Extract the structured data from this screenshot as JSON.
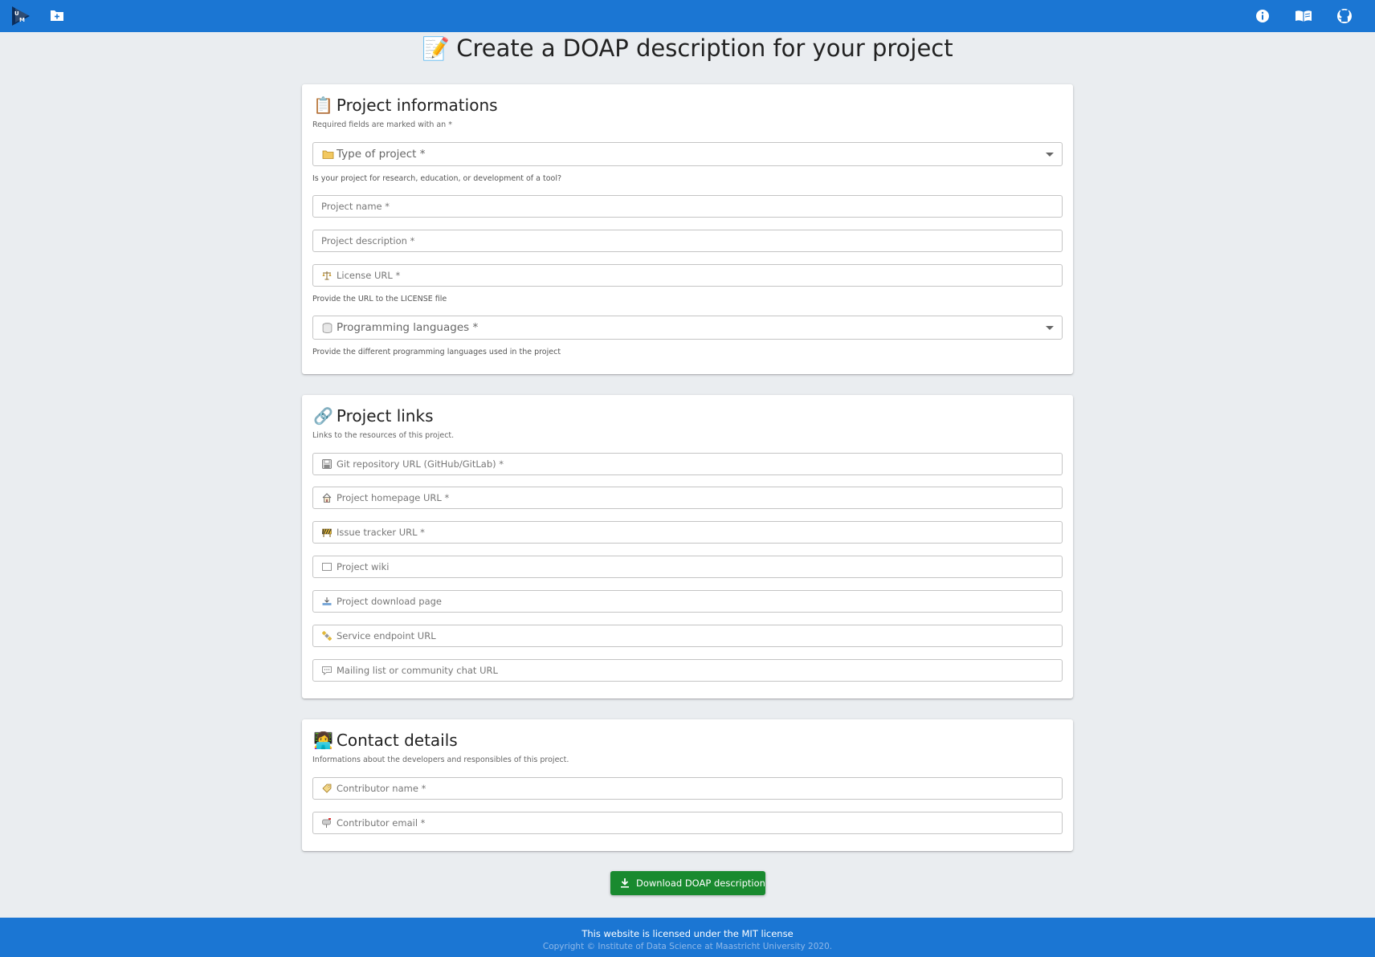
{
  "header": {
    "logo_icon": "maastricht-university-logo",
    "add_project_icon": "folder-plus-icon",
    "right_icons": [
      "info-icon",
      "book-icon",
      "github-icon"
    ],
    "color": "#1b76d3"
  },
  "page": {
    "title_emoji": "📝",
    "title": "Create a DOAP description for your project"
  },
  "project_info": {
    "emoji": "📋",
    "title": "Project informations",
    "subtitle": "Required fields are marked with an *",
    "type_select": {
      "icon": "folder-icon",
      "placeholder": "Type of project *",
      "helper": "Is your project for research, education, or development of a tool?"
    },
    "name_placeholder": "Project name *",
    "description_placeholder": "Project description *",
    "license": {
      "icon": "scales-icon",
      "placeholder": "License URL *",
      "helper": "Provide the URL to the LICENSE file"
    },
    "languages_select": {
      "icon": "database-icon",
      "placeholder": "Programming languages *",
      "helper": "Provide the different programming languages used in the project"
    }
  },
  "project_links": {
    "emoji": "🔗",
    "title": "Project links",
    "subtitle": "Links to the resources of this project.",
    "fields": [
      {
        "icon": "floppy-disk-icon",
        "placeholder": "Git repository URL (GitHub/GitLab) *"
      },
      {
        "icon": "house-icon",
        "placeholder": "Project homepage URL *"
      },
      {
        "icon": "construction-icon",
        "placeholder": "Issue tracker URL *"
      },
      {
        "icon": "book-page-icon",
        "placeholder": "Project wiki"
      },
      {
        "icon": "download-tray-icon",
        "placeholder": "Project download page"
      },
      {
        "icon": "satellite-icon",
        "placeholder": "Service endpoint URL"
      },
      {
        "icon": "speech-bubble-icon",
        "placeholder": "Mailing list or community chat URL"
      }
    ]
  },
  "contact": {
    "emoji": "👩‍💻",
    "title": "Contact details",
    "subtitle": "Informations about the developers and responsibles of this project.",
    "name": {
      "icon": "label-tag-icon",
      "placeholder": "Contributor name *"
    },
    "email": {
      "icon": "mailbox-icon",
      "placeholder": "Contributor email *"
    }
  },
  "download_button": {
    "icon": "download-icon",
    "label": "Download DOAP description",
    "color": "#198a2f"
  },
  "footer": {
    "line1": "This website is licensed under the MIT license",
    "line2": "Copyright © Institute of Data Science at Maastricht University 2020."
  }
}
